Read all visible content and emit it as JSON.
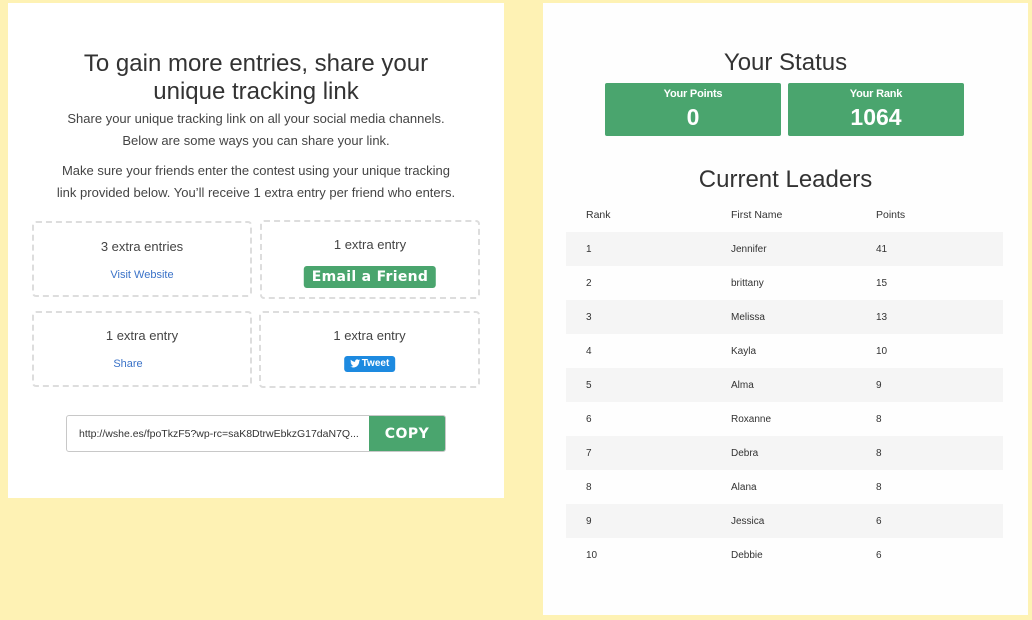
{
  "share_panel": {
    "title_line1": "To gain more entries, share your",
    "title_line2": "unique tracking link",
    "intro_line1": "Share your unique tracking link on all your social media channels.",
    "intro_line2": "Below are some ways you can share your link.",
    "note_line1": "Make sure your friends enter the contest using your unique tracking",
    "note_line2": "link provided below. You’ll receive 1 extra entry per friend who enters.",
    "entries": [
      {
        "label": "3 extra entries",
        "action": "Visit Website",
        "type": "link"
      },
      {
        "label": "1 extra entry",
        "action": "Email a Friend",
        "type": "button"
      },
      {
        "label": "1 extra entry",
        "action": "Share",
        "type": "link"
      },
      {
        "label": "1 extra entry",
        "action": "Tweet",
        "type": "tweet",
        "icon": "twitter-bird-icon"
      }
    ],
    "tracking_link": "http://wshe.es/fpoTkzF5?wp-rc=saK8DtrwEbkzG17daN7Q...",
    "copy_label": "COPY",
    "colors": {
      "accent_green": "#4aa56e",
      "link_blue": "#3b73c8",
      "tweet_blue": "#1d8ae0"
    }
  },
  "status_panel": {
    "title": "Your Status",
    "points_label": "Your Points",
    "points_value": "0",
    "rank_label": "Your Rank",
    "rank_value": "1064"
  },
  "leaders": {
    "title": "Current Leaders",
    "columns": [
      "Rank",
      "First Name",
      "Points"
    ],
    "rows": [
      {
        "rank": "1",
        "name": "Jennifer",
        "points": "41"
      },
      {
        "rank": "2",
        "name": "brittany",
        "points": "15"
      },
      {
        "rank": "3",
        "name": "Melissa",
        "points": "13"
      },
      {
        "rank": "4",
        "name": "Kayla",
        "points": "10"
      },
      {
        "rank": "5",
        "name": "Alma",
        "points": "9"
      },
      {
        "rank": "6",
        "name": "Roxanne",
        "points": "8"
      },
      {
        "rank": "7",
        "name": "Debra",
        "points": "8"
      },
      {
        "rank": "8",
        "name": "Alana",
        "points": "8"
      },
      {
        "rank": "9",
        "name": "Jessica",
        "points": "6"
      },
      {
        "rank": "10",
        "name": "Debbie",
        "points": "6"
      }
    ]
  },
  "page": {
    "background": "#fef2b4"
  }
}
